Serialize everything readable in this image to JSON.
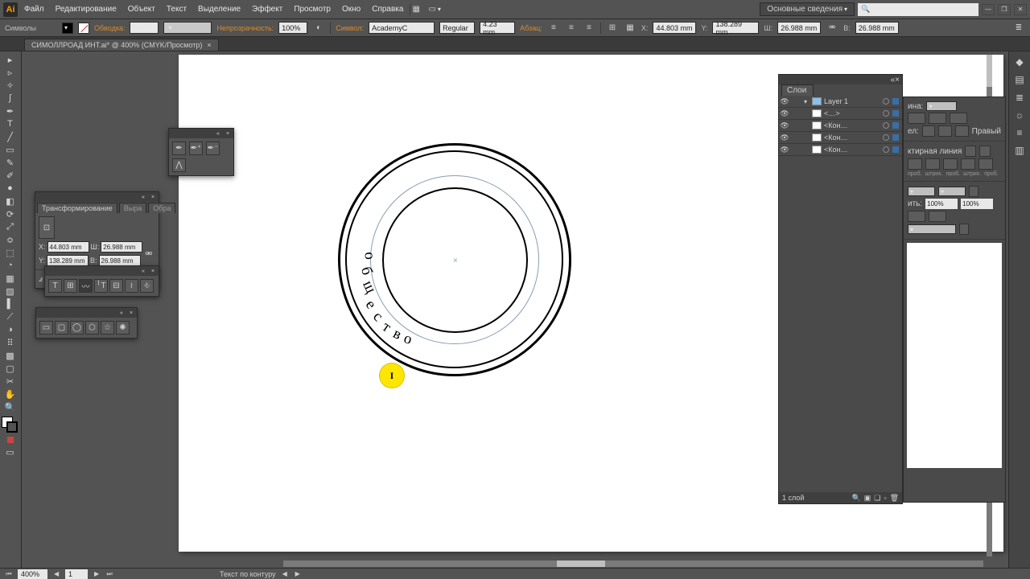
{
  "app": {
    "logo": "Ai"
  },
  "menu": {
    "items": [
      "Файл",
      "Редактирование",
      "Объект",
      "Текст",
      "Выделение",
      "Эффект",
      "Просмотр",
      "Окно",
      "Справка"
    ]
  },
  "workspace": {
    "label": "Основные сведения"
  },
  "ctrl": {
    "left_label": "Символы",
    "obvodka": "Обводка:",
    "neprozr": "Непрозрачность:",
    "opacity": "100%",
    "simvol": "Символ:",
    "font_family": "AcademyC",
    "font_style": "Regular",
    "font_size": "4.23 mm",
    "absatz": "Абзац:",
    "x_label": "X:",
    "x_val": "44.803 mm",
    "y_label": "Y:",
    "y_val": "138.289 mm",
    "w_label": "Ш:",
    "w_val": "26.988 mm",
    "h_label": "В:",
    "h_val": "26.988 mm"
  },
  "doc_tab": {
    "title": "СИМОЛЛРОАД ИНТ.ai* @ 400% (CMYK/Просмотр)"
  },
  "transform_panel": {
    "tab1": "Трансформирование",
    "tab2": "Выра",
    "tab3": "Обра",
    "x_lbl": "X:",
    "x_val": "44.803 mm",
    "y_lbl": "Y:",
    "y_val": "138.289 mm",
    "w_lbl": "Ш:",
    "w_val": "26.988 mm",
    "h_lbl": "В:",
    "h_val": "26.988 mm"
  },
  "small_panel1": {
    "title": ""
  },
  "small_panel2": {
    "title": ""
  },
  "layers": {
    "title": "Слои",
    "rows": [
      {
        "name": "Layer 1",
        "top": true,
        "twirl": "▾"
      },
      {
        "name": "<…>",
        "top": false,
        "twirl": ""
      },
      {
        "name": "<Кон…",
        "top": false,
        "twirl": ""
      },
      {
        "name": "<Кон…",
        "top": false,
        "twirl": ""
      },
      {
        "name": "<Кон…",
        "top": false,
        "twirl": ""
      }
    ],
    "footer": "1 слой"
  },
  "right_panel": {
    "sec1_lbl": "ина:",
    "dash_lbl": "ктирная линия",
    "dash_sub1": "проб.",
    "dash_sub2": "штрих.",
    "dash_sub3": "проб.",
    "dash_sub4": "штрих.",
    "dash_sub5": "проб.",
    "row_lbl1": "ел:",
    "row_lbl2": "Правый",
    "pct1": "100%",
    "pct2": "100%",
    "pct_lbl": "ить:"
  },
  "artboard_text": {
    "chars": [
      "о",
      "б",
      "щ",
      "е",
      "с",
      "т",
      "в",
      "о"
    ]
  },
  "highlight": {
    "char": "I"
  },
  "status": {
    "zoom": "400%",
    "page": "1",
    "tool": "Текст по контуру"
  }
}
